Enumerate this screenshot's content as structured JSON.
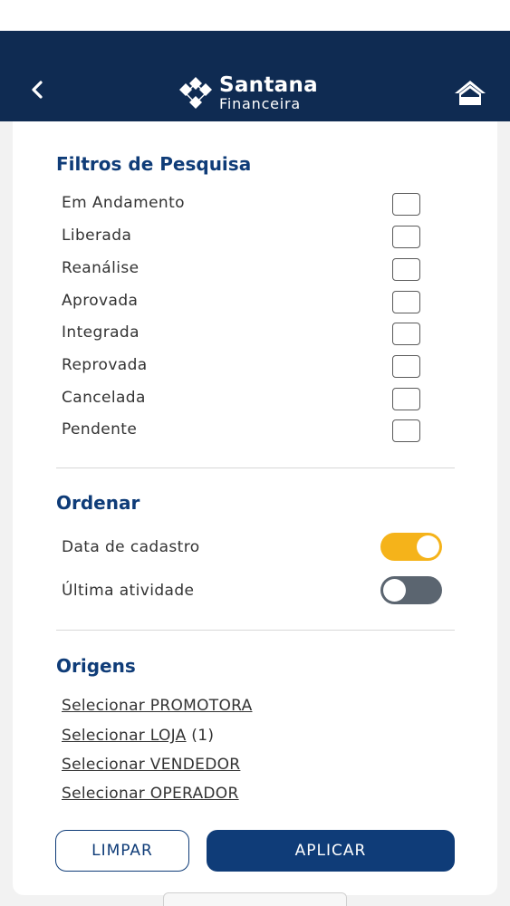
{
  "header": {
    "brand_name": "Santana",
    "brand_sub": "Financeira",
    "background_color": "#0f2b52"
  },
  "filters": {
    "title": "Filtros de Pesquisa",
    "options": [
      {
        "label": "Em Andamento",
        "checked": false
      },
      {
        "label": "Liberada",
        "checked": false
      },
      {
        "label": "Reanálise",
        "checked": false
      },
      {
        "label": "Aprovada",
        "checked": false
      },
      {
        "label": "Integrada",
        "checked": false
      },
      {
        "label": "Reprovada",
        "checked": false
      },
      {
        "label": "Cancelada",
        "checked": false
      },
      {
        "label": "Pendente",
        "checked": false
      }
    ]
  },
  "sort": {
    "title": "Ordenar",
    "options": [
      {
        "label": "Data de cadastro",
        "on": true
      },
      {
        "label": "Última atividade",
        "on": false
      }
    ],
    "toggle_on_color": "#f5b31a",
    "toggle_off_color": "#5b6570"
  },
  "origins": {
    "title": "Origens",
    "links": [
      {
        "label": "Selecionar PROMOTORA",
        "count": ""
      },
      {
        "label": "Selecionar LOJA",
        "count": "(1)"
      },
      {
        "label": "Selecionar VENDEDOR",
        "count": ""
      },
      {
        "label": "Selecionar OPERADOR",
        "count": ""
      }
    ]
  },
  "actions": {
    "clear_label": "LIMPAR",
    "apply_label": "APLICAR",
    "accent_color": "#0f3c78"
  },
  "icons": {
    "back": "chevron-left-icon",
    "home": "home-icon",
    "logo": "santana-logo-mark"
  }
}
